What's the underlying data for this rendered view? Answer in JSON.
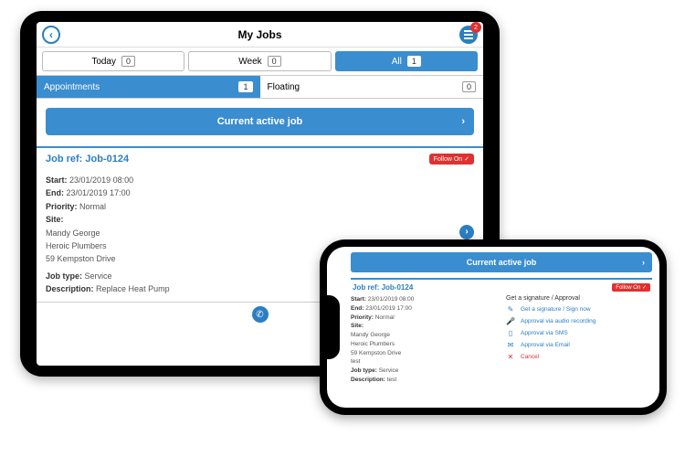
{
  "tablet": {
    "header": {
      "title": "My Jobs",
      "badge": "2"
    },
    "segments": [
      {
        "label": "Today",
        "count": "0",
        "active": false
      },
      {
        "label": "Week",
        "count": "0",
        "active": false
      },
      {
        "label": "All",
        "count": "1",
        "active": true
      }
    ],
    "tabs2": [
      {
        "label": "Appointments",
        "count": "1",
        "active": true
      },
      {
        "label": "Floating",
        "count": "0",
        "active": false
      }
    ],
    "current_btn": "Current active job",
    "job": {
      "ref_label": "Job ref:",
      "ref": "Job-0124",
      "follow": "Follow On ✓",
      "start_label": "Start:",
      "start": "23/01/2019 08:00",
      "end_label": "End:",
      "end": "23/01/2019 17:00",
      "priority_label": "Priority:",
      "priority": "Normal",
      "site_label": "Site:",
      "site_name": "Mandy George",
      "site_company": "Heroic Plumbers",
      "site_addr": "59 Kempston Drive",
      "jobtype_label": "Job type:",
      "jobtype": "Service",
      "desc_label": "Description:",
      "desc": "Replace Heat Pump"
    }
  },
  "phone": {
    "current_btn": "Current active job",
    "job": {
      "ref_label": "Job ref:",
      "ref": "Job-0124",
      "follow": "Follow On ✓",
      "start_label": "Start:",
      "start": "23/01/2019 08:00",
      "end_label": "End:",
      "end": "23/01/2019 17:00",
      "priority_label": "Priority:",
      "priority": "Normal",
      "site_label": "Site:",
      "site_name": "Mandy George",
      "site_company": "Heroic Plumbers",
      "site_addr": "59 Kempston Drive",
      "site_extra": "test",
      "jobtype_label": "Job type:",
      "jobtype": "Service",
      "desc_label": "Description:",
      "desc": "test"
    },
    "approval": {
      "title": "Get a signature / Approval",
      "options": [
        {
          "icon": "✎",
          "label": "Get a signature / Sign now"
        },
        {
          "icon": "🎤",
          "label": "Approval via audio recording"
        },
        {
          "icon": "▯",
          "label": "Approval via SMS"
        },
        {
          "icon": "✉",
          "label": "Approval via Email"
        },
        {
          "icon": "✕",
          "label": "Cancel",
          "cancel": true
        }
      ]
    }
  }
}
